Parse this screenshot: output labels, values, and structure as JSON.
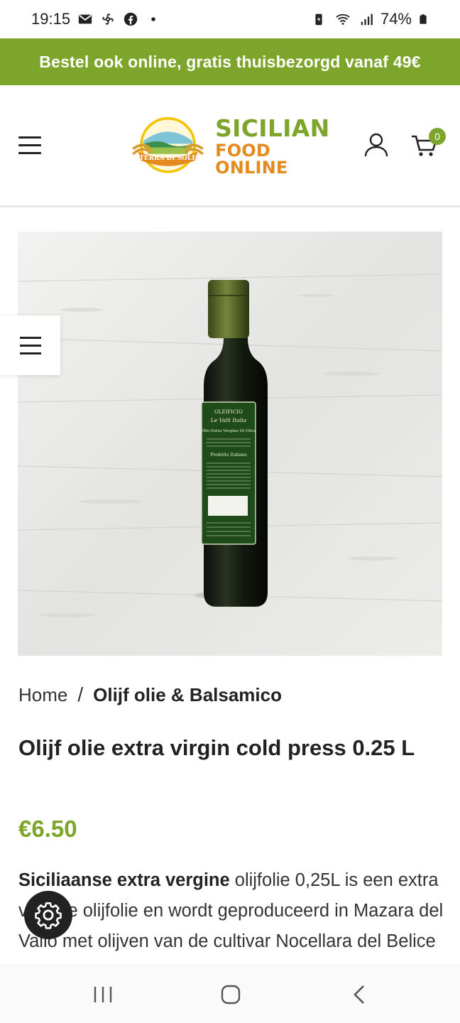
{
  "status_bar": {
    "time": "19:15",
    "battery": "74%",
    "notification_icons": [
      "mail-icon",
      "fan-icon",
      "facebook-icon",
      "dot-icon"
    ],
    "system_icons": [
      "battery-saver-icon",
      "wifi-icon",
      "signal-icon",
      "battery-icon"
    ]
  },
  "promo_banner": {
    "text": "Bestel ook online, gratis thuisbezorgd vanaf 49€",
    "background": "#7da52b"
  },
  "header": {
    "logo": {
      "badge_text": "TERRA DI SOLE",
      "line1": "SICILIAN",
      "line2": "FOOD ONLINE"
    },
    "cart_count": "0",
    "icons": [
      "menu-icon",
      "user-icon",
      "cart-icon"
    ]
  },
  "product_image": {
    "label_brand": "OLEIFICIO",
    "label_name": "Le Valli Italia",
    "label_type": "Olio Extra Vergine Di Oliva",
    "label_origin": "Prodotto Italiano"
  },
  "breadcrumb": {
    "home": "Home",
    "separator": "/",
    "current": "Olijf olie & Balsamico"
  },
  "product": {
    "title": "Olijf olie extra virgin cold press 0.25 L",
    "price": "€6.50",
    "description_bold": "Siciliaanse extra vergine",
    "description_rest": " olijfolie 0,25L is een extra vergine olijfolie en wordt geproduceerd in Mazara del Vallo met olijven van de cultivar Nocellara del Belice"
  },
  "nav_bar": {
    "buttons": [
      "recent-apps-icon",
      "home-icon",
      "back-icon"
    ]
  },
  "colors": {
    "accent": "#7da52b",
    "logo_orange": "#e58a1f",
    "text": "#222222"
  }
}
